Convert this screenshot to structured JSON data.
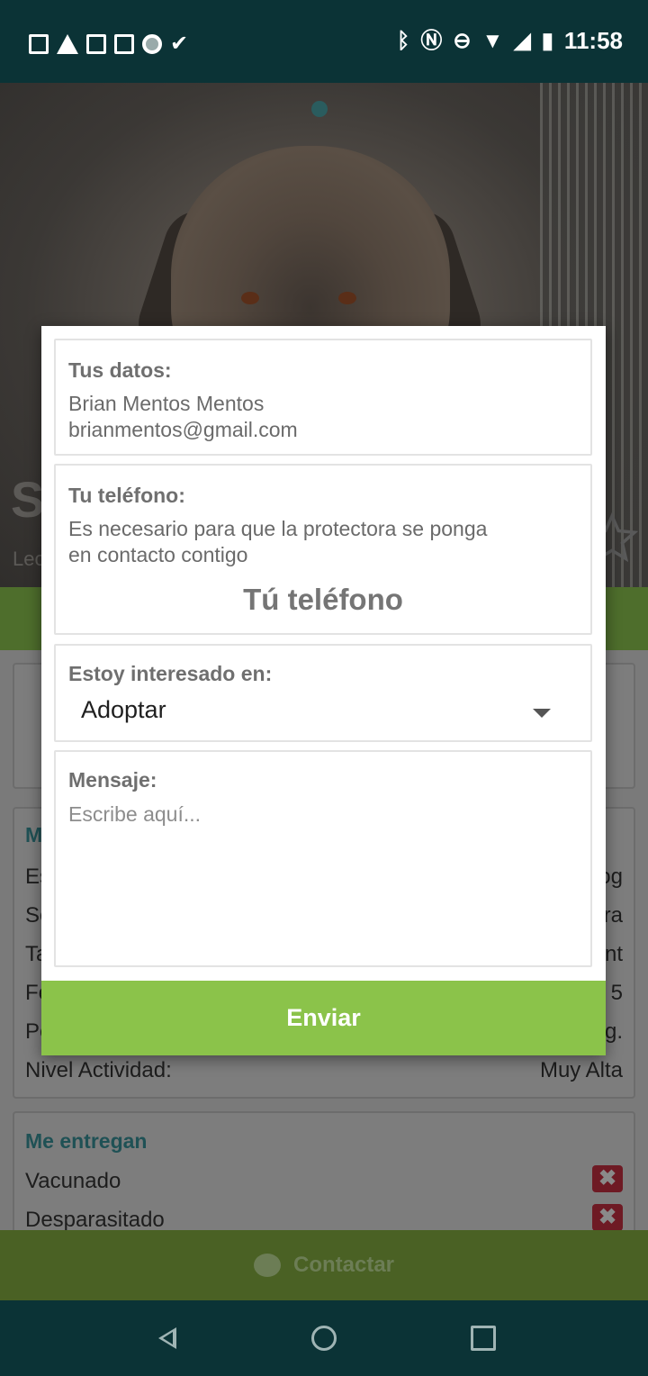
{
  "status_bar": {
    "time": "11:58",
    "left_icons": [
      "notes-icon",
      "warning-icon",
      "gmail-icon",
      "image-icon",
      "record-icon",
      "check-icon"
    ],
    "right_icons": [
      "bluetooth-icon",
      "nfc-icon",
      "dnd-icon",
      "wifi-icon",
      "signal-icon",
      "battery-charging-icon"
    ]
  },
  "background": {
    "hero_title": "Sc",
    "hero_subtitle": "Leo",
    "sections": {
      "details_title": "Mi",
      "rows": [
        {
          "label": "Es",
          "value": "og"
        },
        {
          "label": "Se",
          "value": "ra"
        },
        {
          "label": "Ta",
          "value": "nt"
        },
        {
          "label": "Fe",
          "value": "5"
        },
        {
          "label": "Pe",
          "value": "g."
        },
        {
          "label": "Nivel Actividad:",
          "value": "Muy Alta"
        }
      ],
      "delivery_title": "Me entregan",
      "delivery_items": [
        {
          "label": "Vacunado",
          "mark": "✖"
        },
        {
          "label": "Desparasitado",
          "mark": "✖"
        }
      ]
    },
    "contact_label": "Contactar"
  },
  "dialog": {
    "your_data": {
      "label": "Tus datos:",
      "name": "Brian Mentos Mentos",
      "email": "brianmentos@gmail.com"
    },
    "phone": {
      "label": "Tu teléfono:",
      "description_line1": "Es necesario para que la protectora se ponga",
      "description_line2": "en contacto contigo",
      "placeholder": "Tú teléfono"
    },
    "interest": {
      "label": "Estoy interesado en:",
      "selected": "Adoptar"
    },
    "message": {
      "label": "Mensaje:",
      "placeholder": "Escribe aquí..."
    },
    "send_label": "Enviar"
  }
}
